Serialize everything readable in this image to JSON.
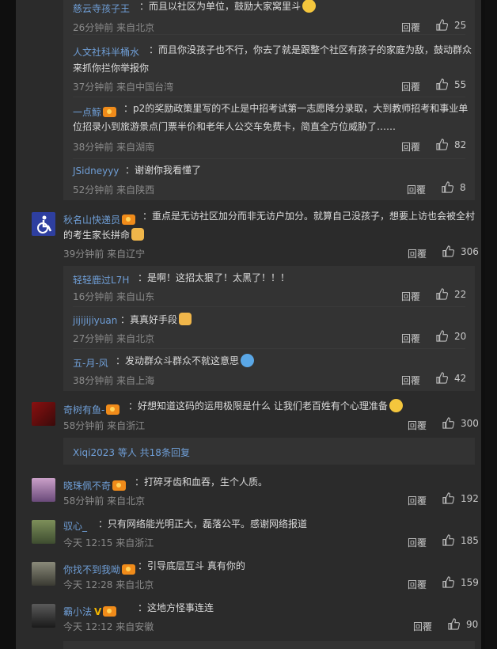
{
  "sub1": [
    {
      "user": "慈云寺孩子王",
      "text": "：而且以社区为单位，鼓励大家窝里斗",
      "meta": "26分钟前 来自北京",
      "reply": "回覆",
      "likes": "25"
    },
    {
      "user": "人文社科半桶水",
      "text": "：而且你没孩子也不行，你去了就是跟整个社区有孩子的家庭为敌，鼓动群众",
      "text2": "来抓你拦你举报你",
      "meta": "37分钟前 来自中国台湾",
      "reply": "回覆",
      "likes": "55"
    },
    {
      "user": "一点鲸",
      "text": "：p2的奖励政策里写的不止是中招考试第一志愿降分录取，大到教师招考和事业单",
      "text2": "位招录小到旅游景点门票半价和老年人公交车免费卡，简直全方位威胁了……",
      "meta": "38分钟前 来自湖南",
      "reply": "回覆",
      "likes": "82"
    },
    {
      "user": "JSidneyyy",
      "text": "：谢谢你我看懂了",
      "meta": "52分钟前 来自陕西",
      "reply": "回覆",
      "likes": "8"
    }
  ],
  "c1": {
    "user": "秋名山快递员",
    "text": "：重点是无访社区加分而非无访户加分。就算自己没孩子，想要上访也会被全村",
    "text2": "的考生家长拼命",
    "meta": "39分钟前 来自辽宁",
    "reply": "回覆",
    "likes": "306"
  },
  "sub2": [
    {
      "user": "轻轻鹿过L7H",
      "text": "：是啊！这招太狠了！太黑了！！！",
      "meta": "16分钟前 来自山东",
      "reply": "回覆",
      "likes": "22"
    },
    {
      "user": "jijijijiyuan",
      "text": "：真真好手段",
      "meta": "27分钟前 来自北京",
      "reply": "回覆",
      "likes": "20"
    },
    {
      "user": "五-月-风",
      "text": "：发动群众斗群众不就这意思",
      "meta": "38分钟前 来自上海",
      "reply": "回覆",
      "likes": "42"
    }
  ],
  "c2": {
    "user": "奇树有鱼-",
    "text": "：好想知道这码的运用极限是什么 让我们老百姓有个心理准备",
    "meta": "58分钟前 来自浙江",
    "reply": "回覆",
    "likes": "300"
  },
  "more": "Xiqi2023 等人 共18条回复",
  "c3": {
    "user": "晓珠佩不奇",
    "text": "：打碎牙齿和血吞，生个人质。",
    "meta": "58分钟前 来自北京",
    "reply": "回覆",
    "likes": "192"
  },
  "c4": {
    "user": "驭心_",
    "text": "：只有网络能光明正大，磊落公平。感谢网络报道",
    "meta": "今天 12:15 来自浙江",
    "reply": "回覆",
    "likes": "185"
  },
  "c5": {
    "user": "你找不到我呦",
    "text": "：引导底层互斗 真有你的",
    "meta": "今天 12:28 来自北京",
    "reply": "回覆",
    "likes": "159"
  },
  "c6": {
    "user": "霸小法",
    "text": "：这地方怪事连连",
    "meta": "今天 12:12 来自安徽",
    "reply": "回覆",
    "likes": "90"
  },
  "colors": {
    "link": "#6f9ed6",
    "panel": "#2b2b2b",
    "subpanel": "#333333",
    "vip": "#f08b1a"
  }
}
